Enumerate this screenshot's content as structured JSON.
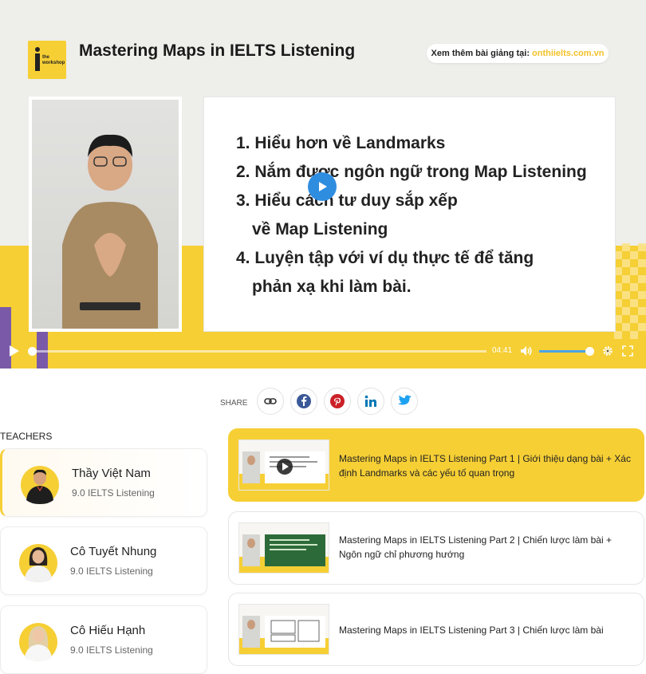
{
  "video": {
    "logo_text": "the workshop",
    "title": "Mastering Maps in IELTS Listening",
    "pill_label": "Xem thêm bài giảng tại:",
    "pill_url": "onthiielts.com.vn",
    "slide_items": [
      {
        "num": "1.",
        "line1": "Hiểu hơn về Landmarks",
        "line2": ""
      },
      {
        "num": "2.",
        "line1": "Nắm được ngôn ngữ trong Map Listening",
        "line2": ""
      },
      {
        "num": "3.",
        "line1": "Hiểu cách tư duy sắp xếp",
        "line2": "về Map Listening"
      },
      {
        "num": "4.",
        "line1": "Luyện tập với ví dụ thực tế để tăng",
        "line2": "phản xạ khi làm bài."
      }
    ],
    "time": "04:41",
    "progress": 0.0,
    "volume": 0.95
  },
  "share": {
    "label": "SHARE"
  },
  "teachers": {
    "label": "TEACHERS",
    "items": [
      {
        "name": "Thầy Việt Nam",
        "score": "9.0 IELTS Listening"
      },
      {
        "name": "Cô Tuyết Nhung",
        "score": "9.0 IELTS Listening"
      },
      {
        "name": "Cô Hiếu Hạnh",
        "score": "9.0 IELTS Listening"
      }
    ]
  },
  "lessons": [
    {
      "title": "Mastering Maps in IELTS Listening Part 1 | Giới thiệu dạng bài + Xác định Landmarks và các yếu tố quan trọng"
    },
    {
      "title": "Mastering Maps in IELTS Listening Part 2 | Chiến lược làm bài + Ngôn ngữ chỉ phương hướng"
    },
    {
      "title": "Mastering Maps in IELTS Listening Part 3 | Chiến lược làm bài"
    }
  ],
  "colors": {
    "accent": "#f6cf35",
    "play": "#2f8de0",
    "purple": "#7a5aa8"
  }
}
